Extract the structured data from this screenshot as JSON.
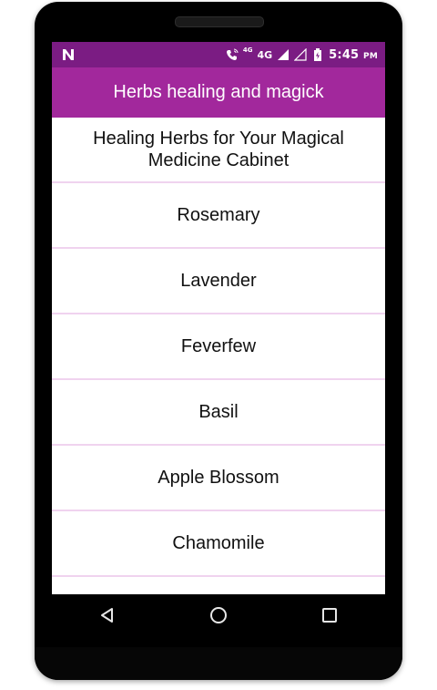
{
  "status_bar": {
    "network_small": "4G",
    "network": "4G",
    "time": "5:45",
    "ampm": "PM",
    "icons": [
      "notification-n-icon",
      "wifi-calling-icon",
      "signal-icon",
      "no-signal-icon",
      "battery-charging-icon"
    ]
  },
  "app_bar": {
    "title": "Herbs healing and magick"
  },
  "list": {
    "items": [
      {
        "label": "Healing Herbs for Your Magical Medicine Cabinet"
      },
      {
        "label": "Rosemary"
      },
      {
        "label": "Lavender"
      },
      {
        "label": "Feverfew"
      },
      {
        "label": "Basil"
      },
      {
        "label": "Apple Blossom"
      },
      {
        "label": "Chamomile"
      },
      {
        "label": ""
      }
    ]
  },
  "nav": {
    "icons": [
      "back-icon",
      "home-icon",
      "recents-icon"
    ]
  },
  "colors": {
    "status_bar": "#7b1c83",
    "app_bar": "#a2289c",
    "divider": "#f0d3ef"
  }
}
